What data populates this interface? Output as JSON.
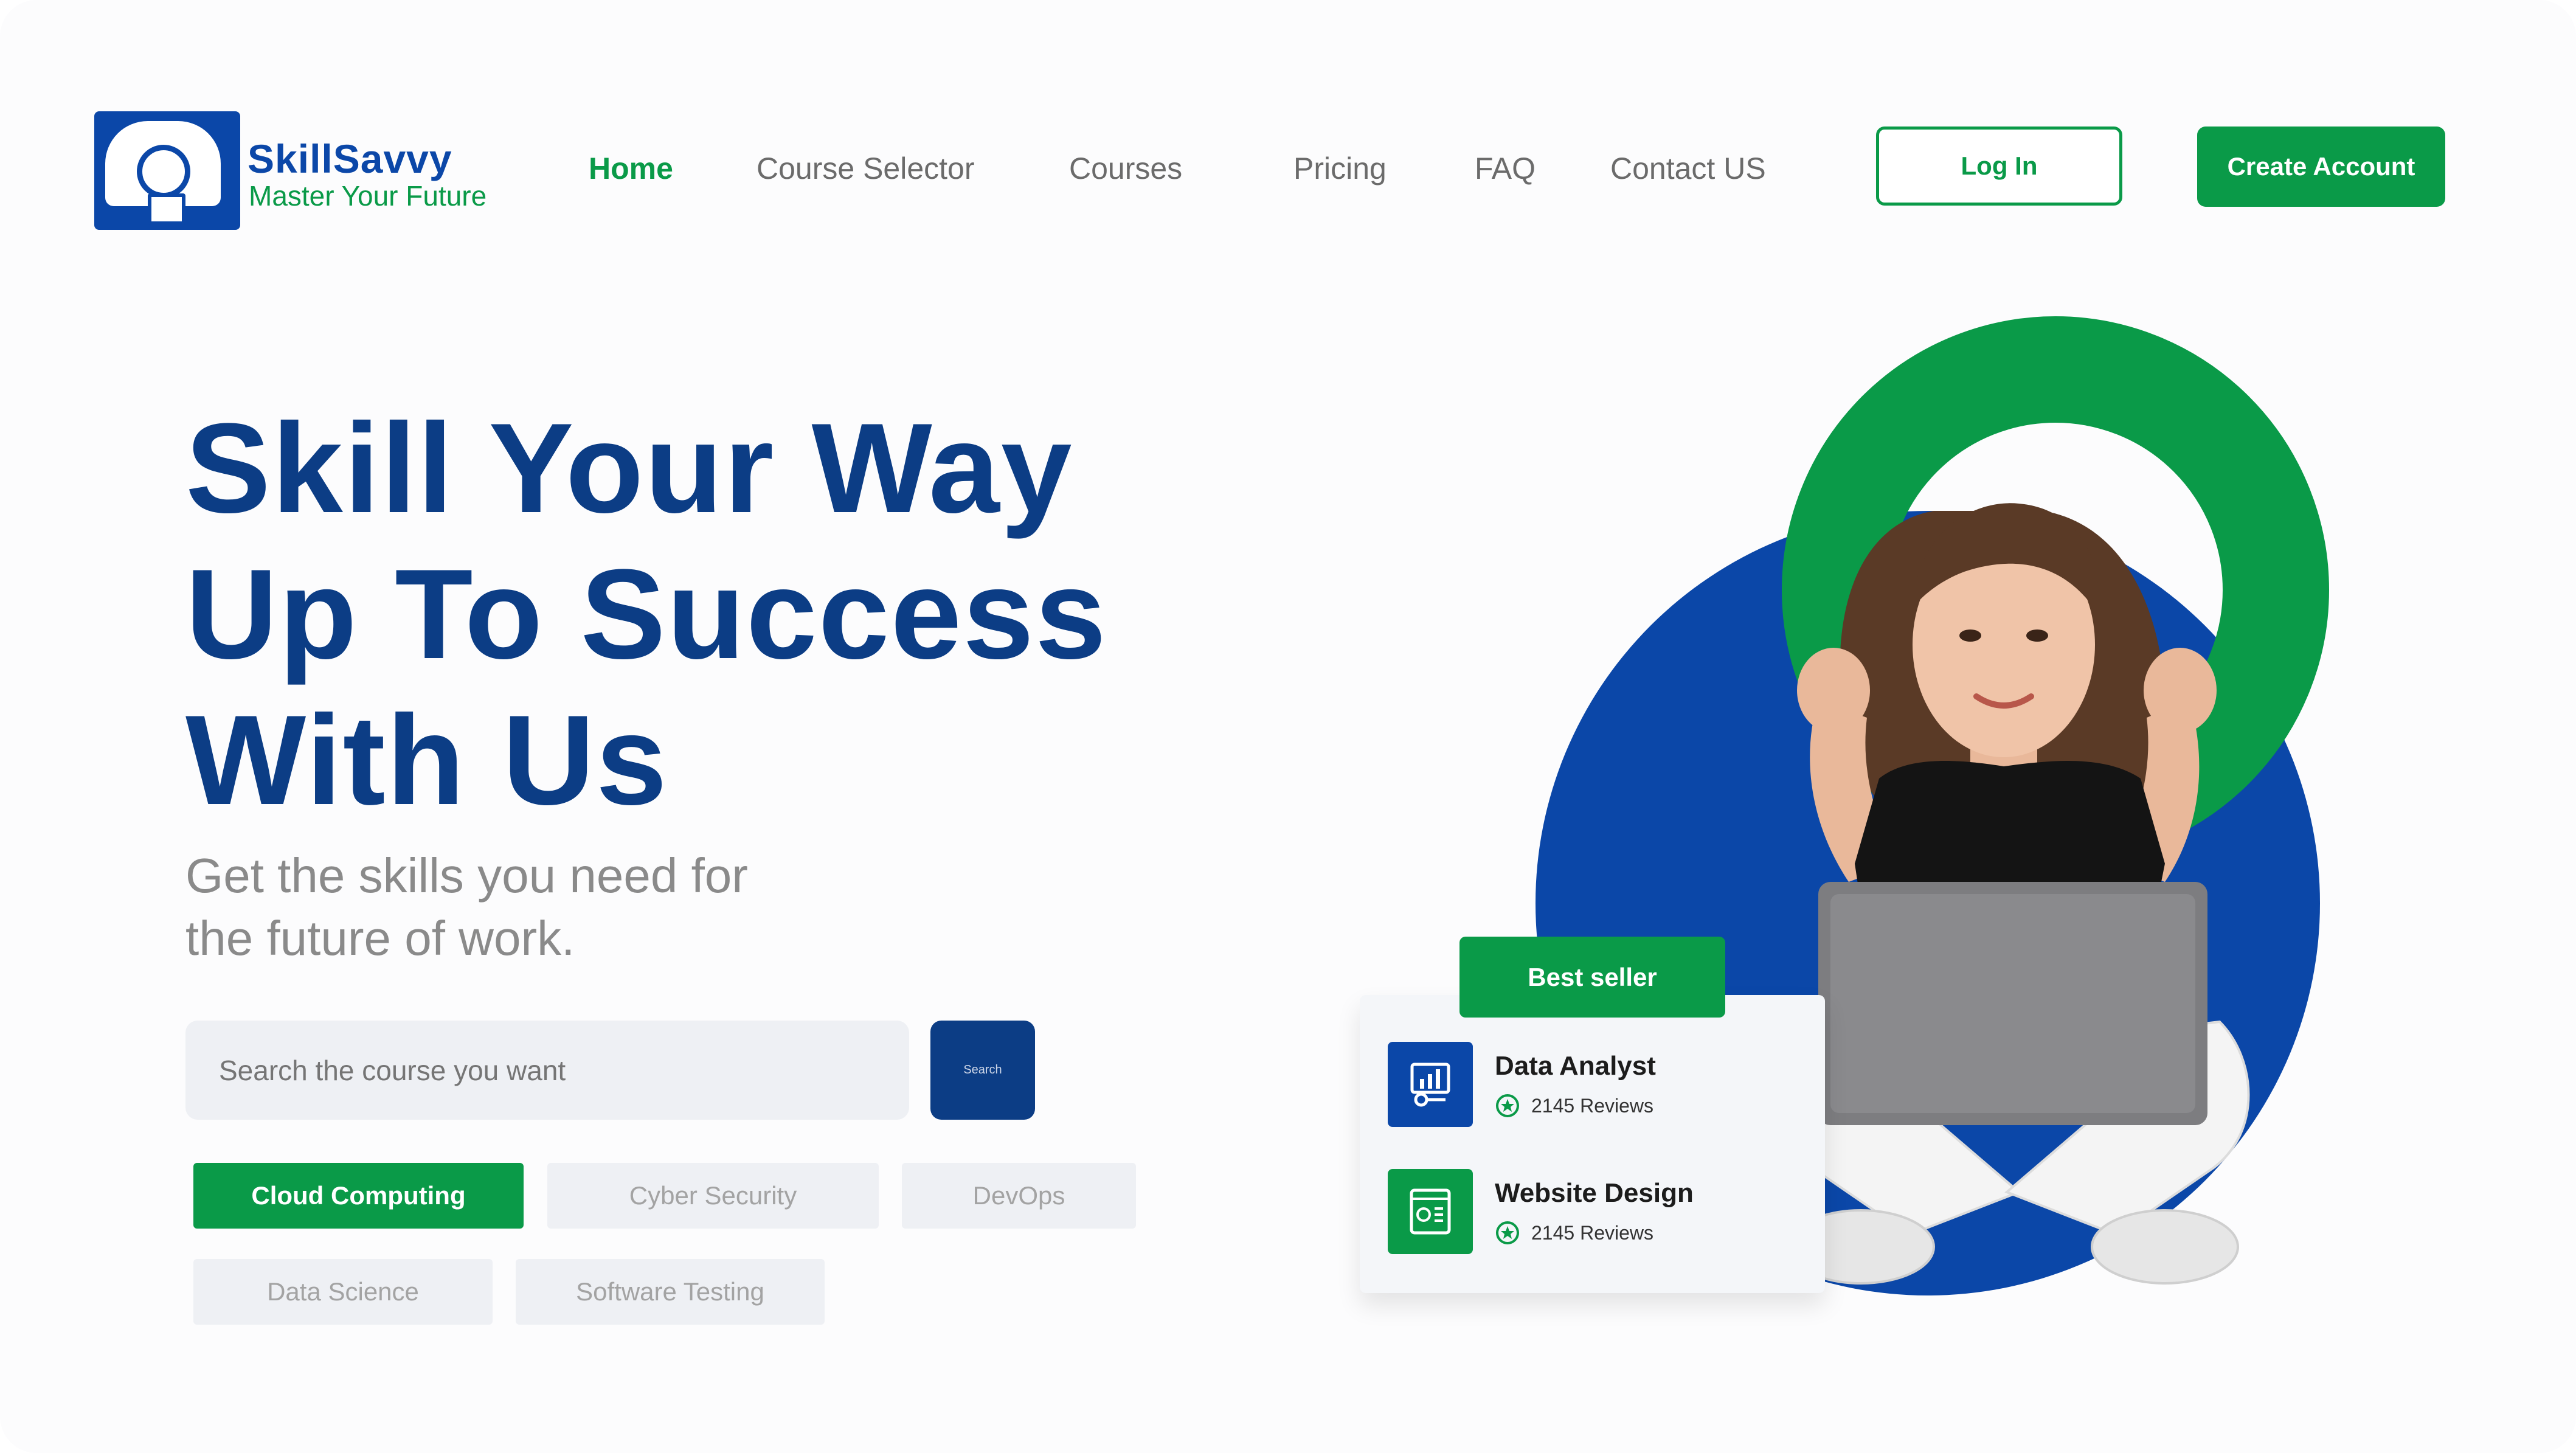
{
  "brand": {
    "name": "SkillSavvy",
    "tagline": "Master Your Future",
    "colors": {
      "primary_blue": "#0c3d85",
      "accent_green": "#0a9a48",
      "logo_blue": "#0b47a8"
    }
  },
  "nav": {
    "items": [
      {
        "label": "Home",
        "active": true
      },
      {
        "label": "Course Selector",
        "active": false
      },
      {
        "label": "Courses",
        "active": false
      },
      {
        "label": "Pricing",
        "active": false
      },
      {
        "label": "FAQ",
        "active": false
      },
      {
        "label": "Contact US",
        "active": false
      }
    ],
    "login_label": "Log In",
    "create_account_label": "Create Account"
  },
  "hero": {
    "headline_lines": [
      "Skill Your Way",
      "Up To Success",
      "With Us"
    ],
    "subtitle_lines": [
      "Get the skills you need for",
      "the future of work."
    ]
  },
  "search": {
    "placeholder": "Search the course you want",
    "button_label": "Search"
  },
  "categories": [
    {
      "label": "Cloud Computing",
      "active": true
    },
    {
      "label": "Cyber Security",
      "active": false
    },
    {
      "label": "DevOps",
      "active": false
    },
    {
      "label": "Data Science",
      "active": false
    },
    {
      "label": "Software Testing",
      "active": false
    }
  ],
  "bestseller": {
    "badge_label": "Best seller",
    "courses": [
      {
        "title": "Data Analyst",
        "reviews": "2145 Reviews",
        "icon": "data-analytics-icon",
        "icon_color": "#0b47a8"
      },
      {
        "title": "Website Design",
        "reviews": "2145 Reviews",
        "icon": "web-design-icon",
        "icon_color": "#0a9a48"
      }
    ]
  }
}
